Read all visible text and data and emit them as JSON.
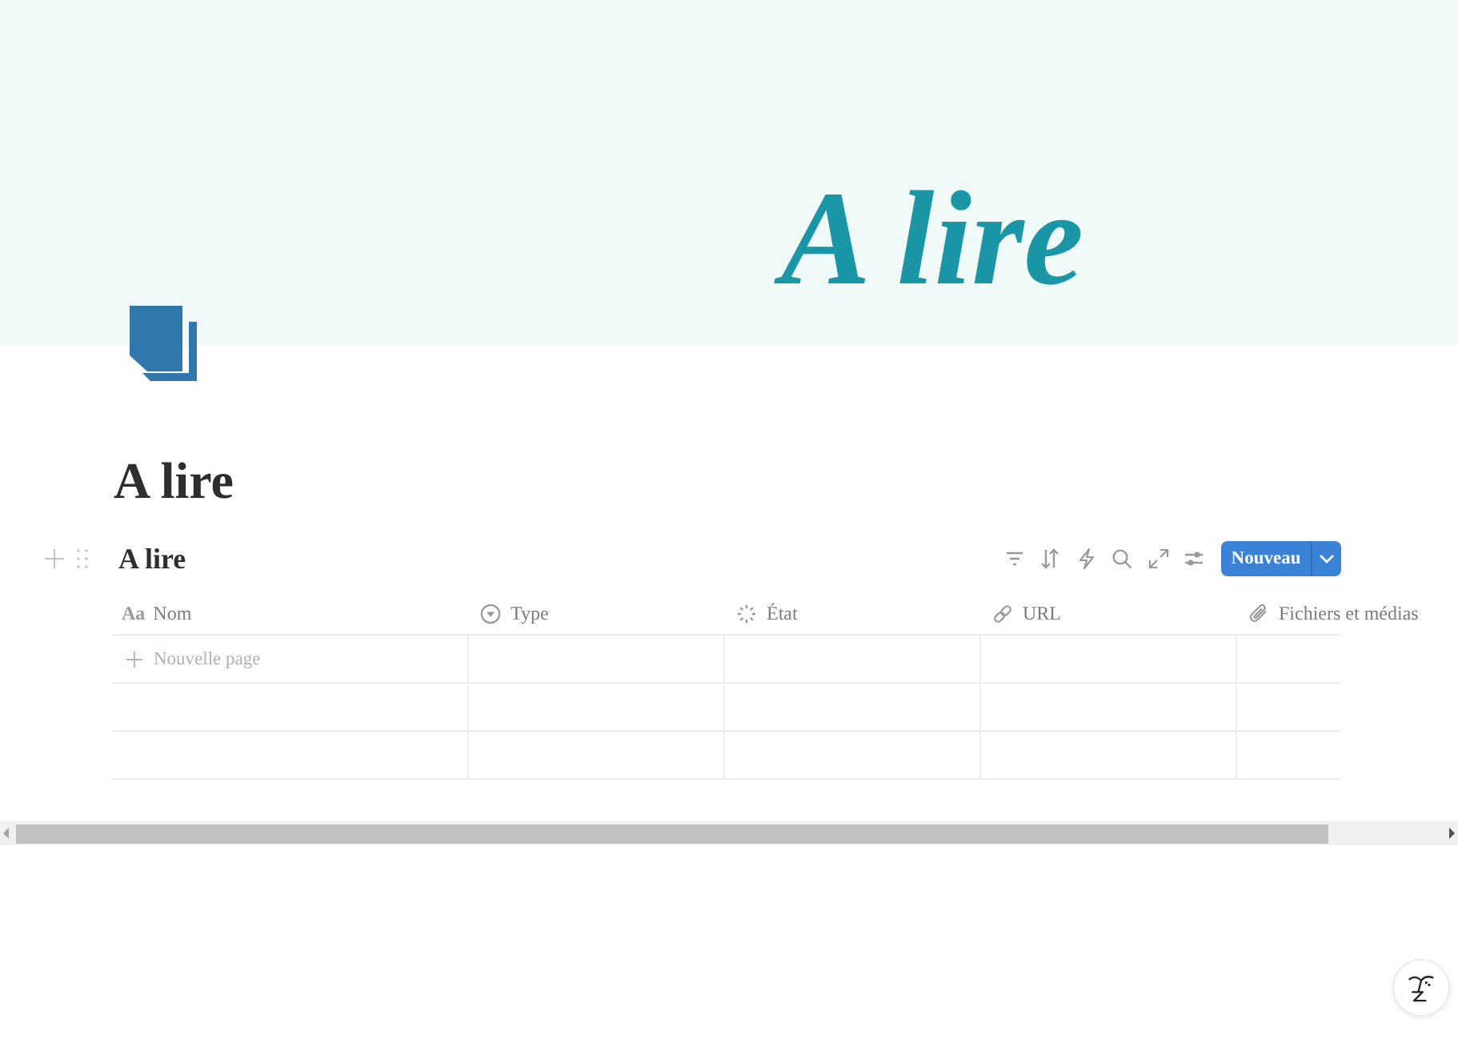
{
  "cover": {
    "text": "A lire"
  },
  "page": {
    "title": "A lire"
  },
  "database": {
    "title": "A lire",
    "new_button": {
      "label": "Nouveau"
    }
  },
  "table": {
    "columns": [
      {
        "kind": "title",
        "glyph": "Aa",
        "label": "Nom"
      },
      {
        "kind": "select",
        "label": "Type"
      },
      {
        "kind": "status",
        "label": "État"
      },
      {
        "kind": "url",
        "label": "URL"
      },
      {
        "kind": "files",
        "label": "Fichiers et médias"
      }
    ],
    "rows": [
      {
        "kind": "new",
        "label": "Nouvelle page"
      },
      {
        "kind": "blank"
      },
      {
        "kind": "blank"
      }
    ]
  }
}
